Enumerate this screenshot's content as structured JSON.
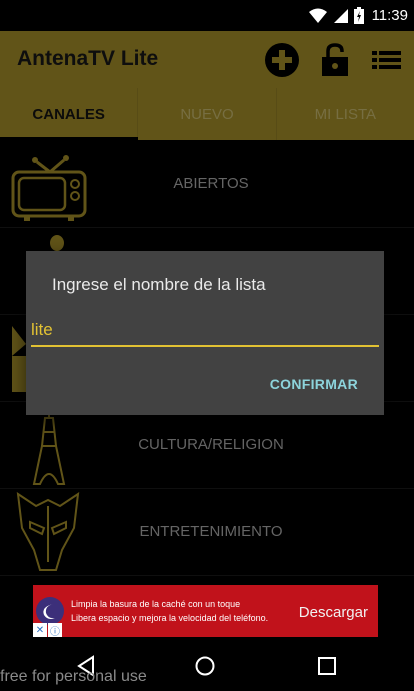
{
  "status_bar": {
    "time": "11:39",
    "icons": [
      "wifi-icon",
      "signal-icon",
      "battery-icon"
    ]
  },
  "app_bar": {
    "title": "AntenaTV Lite",
    "actions": [
      "add-icon",
      "lock-open-icon",
      "list-menu-icon"
    ]
  },
  "tabs": [
    {
      "label": "CANALES",
      "selected": true
    },
    {
      "label": "NUEVO",
      "selected": false
    },
    {
      "label": "MI LISTA",
      "selected": false
    }
  ],
  "channel_list": {
    "items": [
      {
        "label": "ABIERTOS",
        "icon": "retro-tv-icon"
      },
      {
        "label": "",
        "icon": "antenna-icon"
      },
      {
        "label": "",
        "icon": "film-icon"
      },
      {
        "label": "CULTURA/RELIGION",
        "icon": "eiffel-tower-icon"
      },
      {
        "label": "ENTRETENIMIENTO",
        "icon": "decepticon-icon"
      }
    ]
  },
  "dialog": {
    "title": "Ingrese el nombre de la lista",
    "input_value": "lite",
    "confirm_label": "CONFIRMAR"
  },
  "ad_banner": {
    "line1": "Limpia la basura de la caché con un toque",
    "line2": "Libera espacio y mejora la velocidad del teléfono.",
    "cta": "Descargar"
  },
  "nav_bar": [
    "back-icon",
    "home-icon",
    "recents-icon"
  ],
  "watermark": "free for personal use",
  "colors": {
    "accent": "#b1992c",
    "dialog_bg": "#424242",
    "input_underline": "#e2c233",
    "confirm": "#8dd4dc",
    "ad_bg": "#c1121b"
  }
}
